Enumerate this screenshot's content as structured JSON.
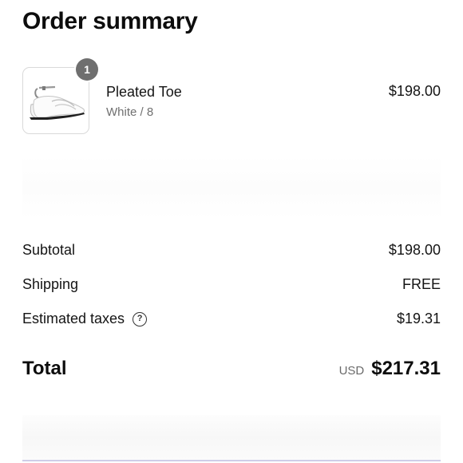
{
  "header": {
    "title": "Order summary"
  },
  "line_item": {
    "quantity": "1",
    "name": "Pleated Toe",
    "variant": "White / 8",
    "price": "$198.00",
    "image_icon": "shoe-thumbnail"
  },
  "summary": {
    "subtotal_label": "Subtotal",
    "subtotal_value": "$198.00",
    "shipping_label": "Shipping",
    "shipping_value": "FREE",
    "taxes_label": "Estimated taxes",
    "taxes_help_icon": "question-circle-icon",
    "taxes_help_glyph": "?",
    "taxes_value": "$19.31"
  },
  "total": {
    "label": "Total",
    "currency": "USD",
    "amount": "$217.31"
  },
  "colors": {
    "badge": "#6f6f6f",
    "text": "#141414",
    "muted": "#707070"
  }
}
